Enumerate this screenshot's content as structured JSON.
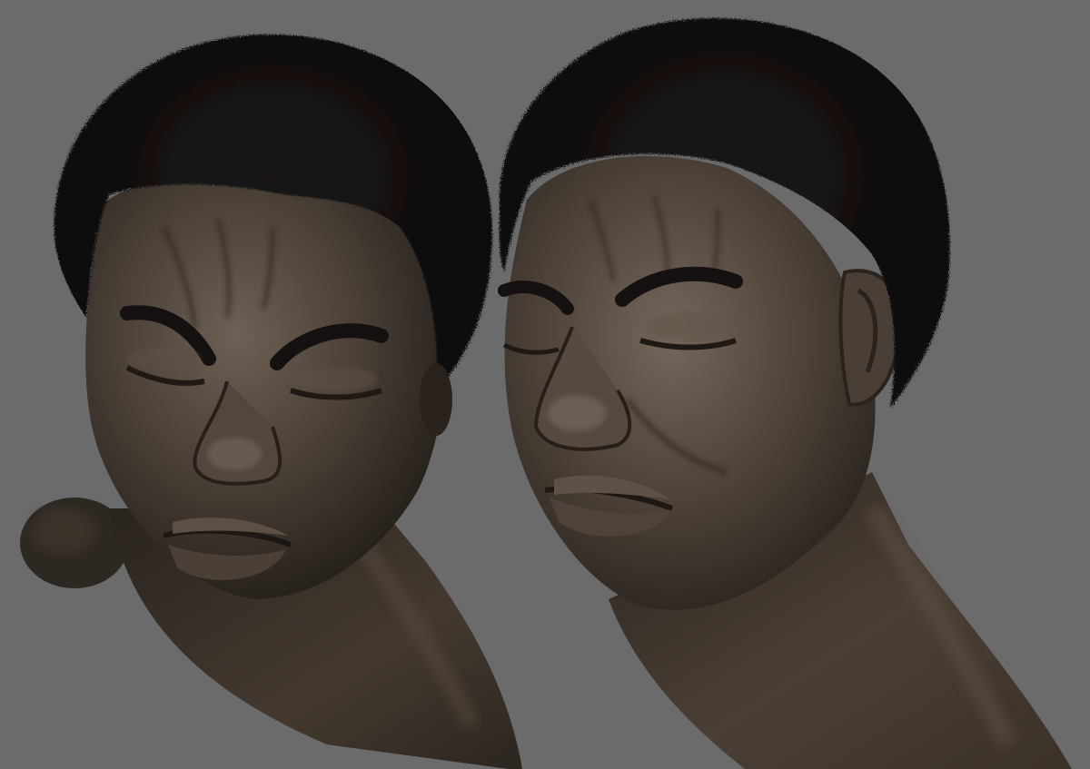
{
  "scene": {
    "background_color": "#6b6b6b",
    "skin_color": "#4a4038",
    "skin_highlight": "#6a5c50",
    "skin_shadow": "#221c18",
    "hair_color": "#0e0d0d",
    "objects": [
      {
        "name": "sculpt-head-front-three-quarter"
      },
      {
        "name": "sculpt-head-side-three-quarter"
      }
    ]
  }
}
